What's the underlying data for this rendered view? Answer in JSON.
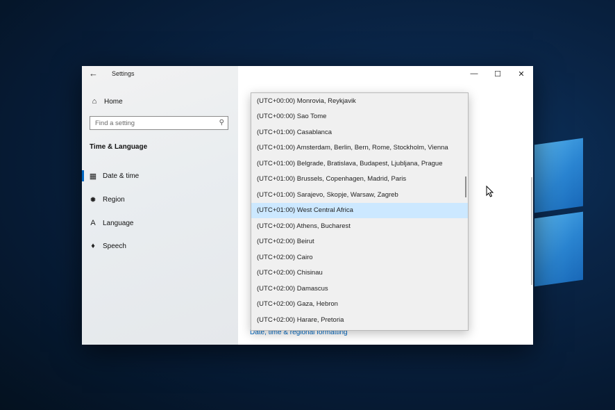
{
  "window": {
    "title": "Settings",
    "back_icon": "←",
    "min_icon": "—",
    "max_icon": "☐",
    "close_icon": "✕"
  },
  "sidebar": {
    "home": {
      "icon": "⌂",
      "label": "Home"
    },
    "search": {
      "placeholder": "Find a setting",
      "icon": "⚲"
    },
    "section_title": "Time & Language",
    "items": [
      {
        "icon": "▦",
        "label": "Date & time",
        "active": true
      },
      {
        "icon": "✹",
        "label": "Region",
        "active": false
      },
      {
        "icon": "A",
        "label": "Language",
        "active": false
      },
      {
        "icon": "♦",
        "label": "Speech",
        "active": false
      }
    ]
  },
  "content": {
    "footer_link": "Date, time & regional formatting"
  },
  "timezone_dropdown": {
    "selected": "(UTC+01:00) West Central Africa",
    "options": [
      "(UTC+00:00) Monrovia, Reykjavik",
      "(UTC+00:00) Sao Tome",
      "(UTC+01:00) Casablanca",
      "(UTC+01:00) Amsterdam, Berlin, Bern, Rome, Stockholm, Vienna",
      "(UTC+01:00) Belgrade, Bratislava, Budapest, Ljubljana, Prague",
      "(UTC+01:00) Brussels, Copenhagen, Madrid, Paris",
      "(UTC+01:00) Sarajevo, Skopje, Warsaw, Zagreb",
      "(UTC+01:00) West Central Africa",
      "(UTC+02:00) Athens, Bucharest",
      "(UTC+02:00) Beirut",
      "(UTC+02:00) Cairo",
      "(UTC+02:00) Chisinau",
      "(UTC+02:00) Damascus",
      "(UTC+02:00) Gaza, Hebron",
      "(UTC+02:00) Harare, Pretoria"
    ]
  },
  "colors": {
    "accent": "#0067c0",
    "selection": "#cce8ff"
  }
}
